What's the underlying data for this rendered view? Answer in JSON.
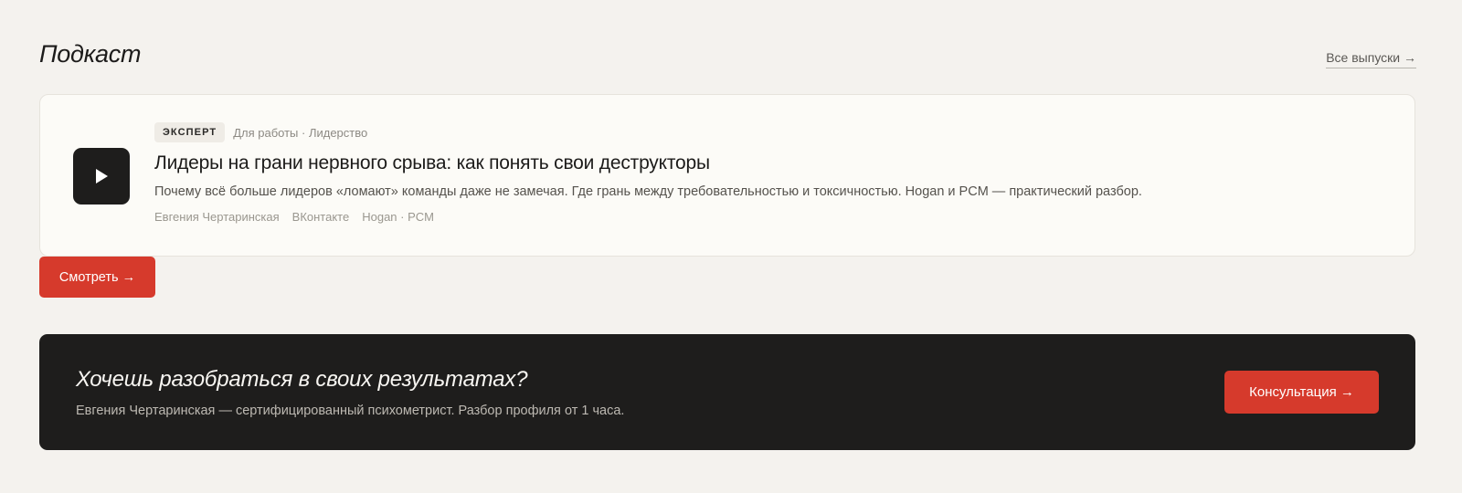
{
  "section": {
    "title": "Подкаст",
    "all_link": "Все выпуски →"
  },
  "episode": {
    "badge": "ЭКСПЕРТ",
    "category": "Для работы · Лидерство",
    "title": "Лидеры на грани нервного срыва: как понять свои деструкторы",
    "description": "Почему всё больше лидеров «ломают» команды даже не замечая. Где грань между требовательностью и токсичностью. Hogan и PCM — практический разбор.",
    "tags": [
      "Евгения Чертаринская",
      "ВКонтакте",
      "Hogan · PCM"
    ],
    "play_icon": "play-icon",
    "watch_label": "Смотреть →"
  },
  "cta": {
    "title": "Хочешь разобраться в своих результатах?",
    "subtitle": "Евгения Чертаринская — сертифицированный психометрист. Разбор профиля от 1 часа.",
    "button_label": "Консультация →"
  },
  "colors": {
    "background": "#f4f2ee",
    "accent": "#d63a2c",
    "dark": "#1e1d1c",
    "card": "#fcfbf7"
  }
}
